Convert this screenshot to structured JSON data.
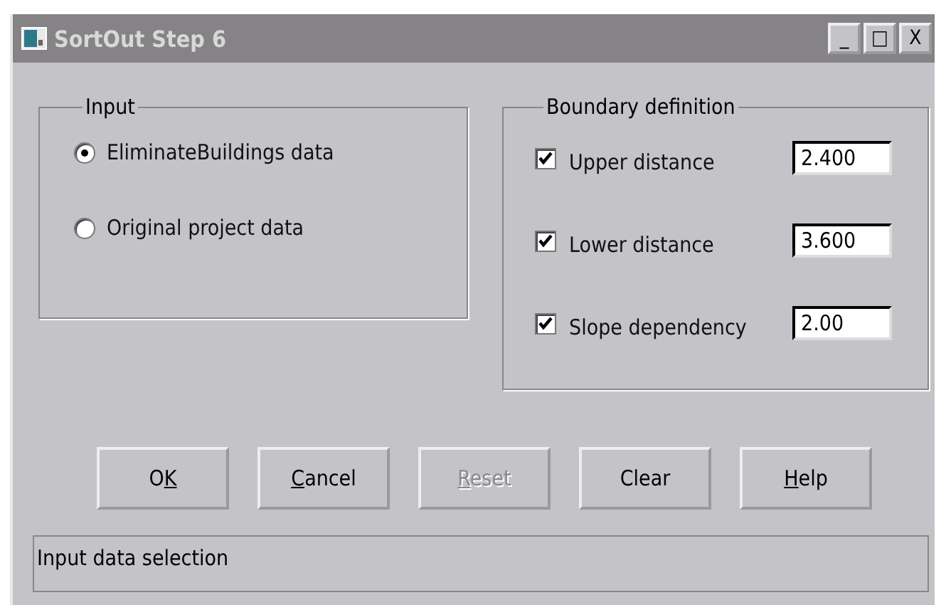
{
  "window": {
    "title": "SortOut Step 6",
    "controls": [
      "_",
      "□",
      "X"
    ]
  },
  "input_group": {
    "title": "Input",
    "options": [
      {
        "label": "EliminateBuildings data",
        "selected": true
      },
      {
        "label": "Original project data",
        "selected": false
      }
    ]
  },
  "boundary_group": {
    "title": "Boundary definition",
    "rows": [
      {
        "label": "Upper distance",
        "checked": true,
        "value": "2.400"
      },
      {
        "label": "Lower distance",
        "checked": true,
        "value": "3.600"
      },
      {
        "label": "Slope dependency",
        "checked": true,
        "value": "2.00"
      }
    ]
  },
  "buttons": [
    {
      "label": [
        {
          "text": "O",
          "underlined": false
        },
        {
          "text": "K",
          "underlined": true
        }
      ],
      "disabled": false
    },
    {
      "label": [
        {
          "text": "C",
          "underlined": true
        },
        {
          "text": "ancel",
          "underlined": false
        }
      ],
      "disabled": false
    },
    {
      "label": [
        {
          "text": "R",
          "underlined": true
        },
        {
          "text": "eset",
          "underlined": false
        }
      ],
      "disabled": true
    },
    {
      "label": [
        {
          "text": "Clear",
          "underlined": false
        }
      ],
      "disabled": false
    },
    {
      "label": [
        {
          "text": "H",
          "underlined": true
        },
        {
          "text": "elp",
          "underlined": false
        }
      ],
      "disabled": false
    }
  ],
  "status_bar": "Input data selection"
}
